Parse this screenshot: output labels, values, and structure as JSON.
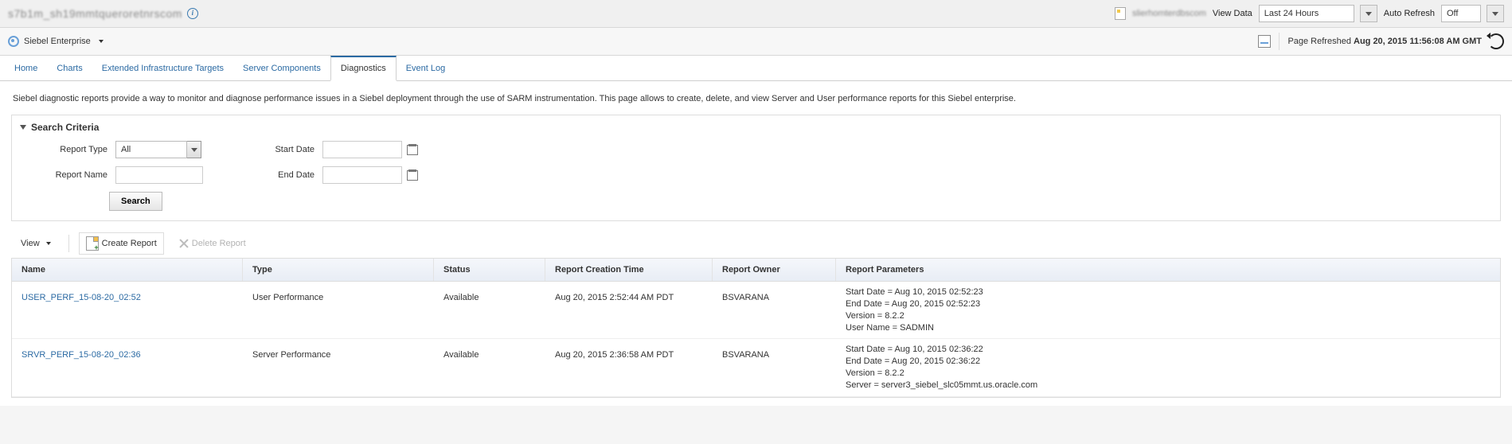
{
  "top": {
    "title_obscured": "s7b1m_sh19mmtqueroretnrscom",
    "server_obscured": "slierhomterdbscom",
    "view_data_label": "View Data",
    "view_data_value": "Last 24 Hours",
    "auto_refresh_label": "Auto Refresh",
    "auto_refresh_value": "Off"
  },
  "sub": {
    "menu_label": "Siebel Enterprise",
    "page_refreshed_label": "Page Refreshed",
    "page_refreshed_time": "Aug 20, 2015 11:56:08 AM GMT"
  },
  "tabs": [
    {
      "label": "Home"
    },
    {
      "label": "Charts"
    },
    {
      "label": "Extended Infrastructure Targets"
    },
    {
      "label": "Server Components"
    },
    {
      "label": "Diagnostics",
      "active": true
    },
    {
      "label": "Event Log"
    }
  ],
  "intro": "Siebel diagnostic reports provide a way to monitor and diagnose performance issues in a Siebel deployment through the use of SARM instrumentation. This page allows to create, delete, and view Server and User performance reports for this Siebel enterprise.",
  "search": {
    "section_title": "Search Criteria",
    "labels": {
      "report_type": "Report Type",
      "report_name": "Report Name",
      "start_date": "Start Date",
      "end_date": "End Date"
    },
    "report_type_value": "All",
    "report_name_value": "",
    "start_date_value": "",
    "end_date_value": "",
    "search_button": "Search"
  },
  "toolbar": {
    "view": "View",
    "create": "Create Report",
    "delete": "Delete Report"
  },
  "grid": {
    "columns": [
      "Name",
      "Type",
      "Status",
      "Report Creation Time",
      "Report Owner",
      "Report Parameters"
    ],
    "rows": [
      {
        "name": "USER_PERF_15-08-20_02:52",
        "type": "User Performance",
        "status": "Available",
        "creation": "Aug 20, 2015 2:52:44 AM PDT",
        "owner": "BSVARANA",
        "params": "Start Date = Aug 10, 2015 02:52:23\nEnd Date = Aug 20, 2015 02:52:23\nVersion = 8.2.2\nUser Name = SADMIN"
      },
      {
        "name": "SRVR_PERF_15-08-20_02:36",
        "type": "Server Performance",
        "status": "Available",
        "creation": "Aug 20, 2015 2:36:58 AM PDT",
        "owner": "BSVARANA",
        "params": "Start Date = Aug 10, 2015 02:36:22\nEnd Date = Aug 20, 2015 02:36:22\nVersion = 8.2.2\nServer = server3_siebel_slc05mmt.us.oracle.com"
      }
    ]
  }
}
